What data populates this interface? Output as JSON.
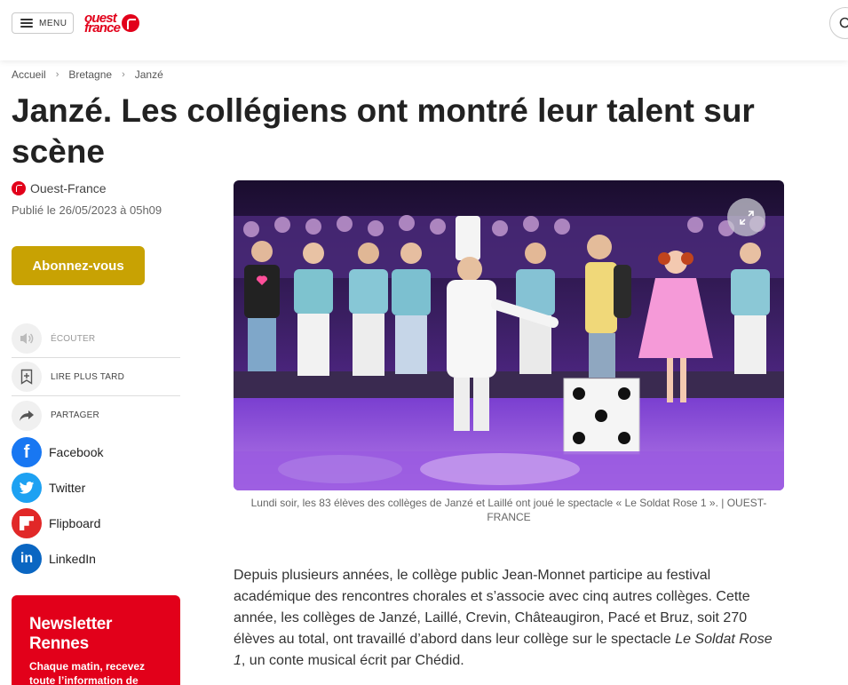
{
  "header": {
    "menu_label": "MENU",
    "logo_line1": "ouest",
    "logo_line2": "france"
  },
  "breadcrumb": [
    "Accueil",
    "Bretagne",
    "Janzé"
  ],
  "article": {
    "title": "Janzé. Les collégiens ont montré leur talent sur scène",
    "author": "Ouest-France",
    "published": "Publié le 26/05/2023 à 05h09",
    "caption": "Lundi soir, les 83 élèves des collèges de Janzé et Laillé ont joué le spectacle « Le Soldat Rose 1 ». | OUEST-FRANCE",
    "body_part1": "Depuis plusieurs années, le collège public Jean-Monnet participe au festival académique des rencontres chorales et s’associe avec cinq autres collèges. Cette année, les collèges de Janzé, Laillé, Crevin, Châteaugiron, Pacé et Bruz, soit 270 élèves au total, ont travaillé d’abord dans leur collège sur le spectacle ",
    "body_em": "Le Soldat Rose 1",
    "body_part2": ", un conte musical écrit par Chédid."
  },
  "subscribe_label": "Abonnez-vous",
  "actions": {
    "listen": "ÉCOUTER",
    "read_later": "LIRE PLUS TARD",
    "share": "PARTAGER"
  },
  "social": [
    {
      "label": "Facebook",
      "color": "#1877f2",
      "icon": "facebook-icon",
      "glyph": "f"
    },
    {
      "label": "Twitter",
      "color": "#1da1f2",
      "icon": "twitter-icon",
      "glyph": ""
    },
    {
      "label": "Flipboard",
      "color": "#e12828",
      "icon": "flipboard-icon",
      "glyph": ""
    },
    {
      "label": "LinkedIn",
      "color": "#0a66c2",
      "icon": "linkedin-icon",
      "glyph": "in"
    }
  ],
  "newsletter": {
    "title": "Newsletter Rennes",
    "text": "Chaque matin, recevez toute l’information de Rennes et de ses environs"
  },
  "colors": {
    "brand_red": "#e2001a",
    "subscribe_gold": "#c8a203",
    "stage_purple": "#8a2be2"
  }
}
